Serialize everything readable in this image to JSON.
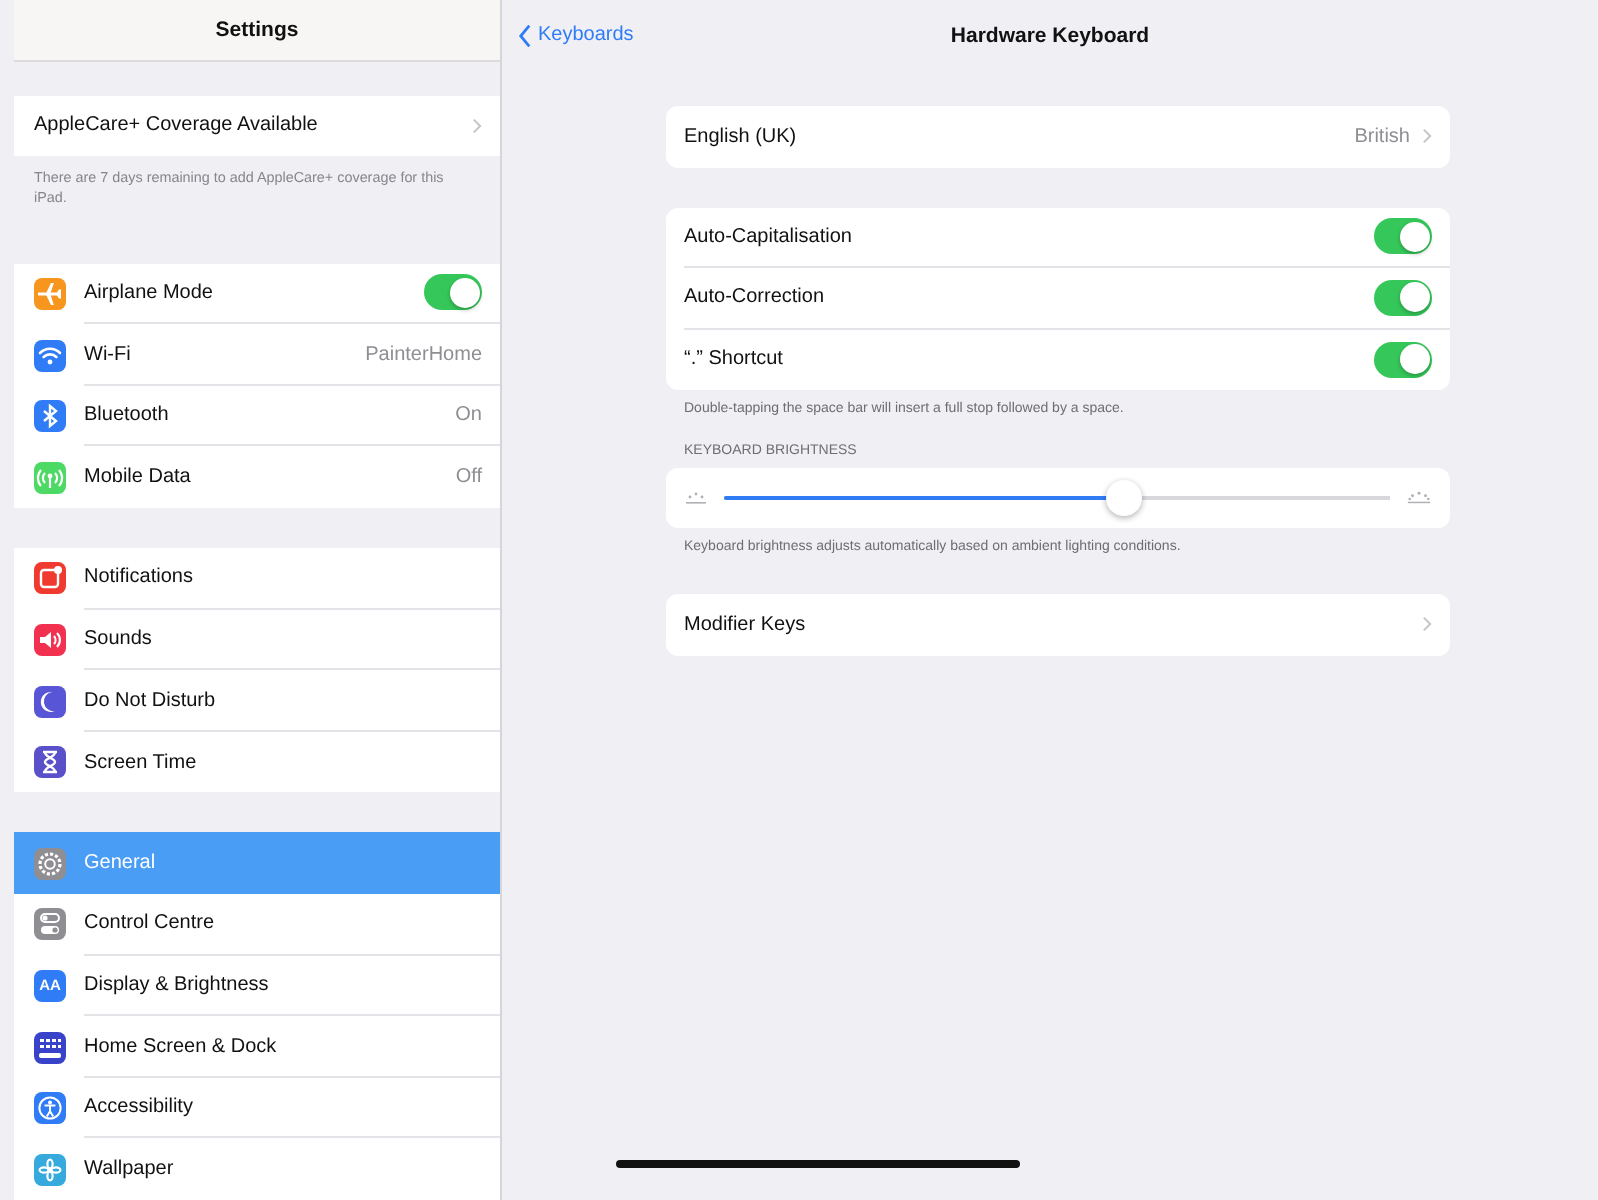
{
  "sidebar": {
    "title": "Settings",
    "groups": [
      {
        "rows": [
          {
            "label": "AppleCare+ Coverage Available",
            "kind": "link",
            "selected": false
          }
        ],
        "footer": "There are 7 days remaining to add AppleCare+ coverage for this iPad."
      },
      {
        "rows": [
          {
            "label": "Airplane Mode",
            "kind": "toggle",
            "on": true,
            "selected": false,
            "color": "#f7961e"
          },
          {
            "label": "Wi-Fi",
            "kind": "value",
            "value": "PainterHome",
            "selected": false,
            "color": "#2f7cf6"
          },
          {
            "label": "Bluetooth",
            "kind": "value",
            "value": "On",
            "selected": false,
            "color": "#2f7cf6"
          },
          {
            "label": "Mobile Data",
            "kind": "value",
            "value": "Off",
            "selected": false,
            "color": "#4cd964"
          }
        ]
      },
      {
        "rows": [
          {
            "label": "Notifications",
            "kind": "plain",
            "selected": false,
            "color": "#f03a2f"
          },
          {
            "label": "Sounds",
            "kind": "plain",
            "selected": false,
            "color": "#f2304f"
          },
          {
            "label": "Do Not Disturb",
            "kind": "plain",
            "selected": false,
            "color": "#5856d6"
          },
          {
            "label": "Screen Time",
            "kind": "plain",
            "selected": false,
            "color": "#5a50c9"
          }
        ]
      },
      {
        "rows": [
          {
            "label": "General",
            "kind": "plain",
            "selected": true,
            "color": "#8e8e93"
          },
          {
            "label": "Control Centre",
            "kind": "plain",
            "selected": false,
            "color": "#8e8e93"
          },
          {
            "label": "Display & Brightness",
            "kind": "plain",
            "selected": false,
            "color": "#2f7cf6",
            "icon_text": "AA"
          },
          {
            "label": "Home Screen & Dock",
            "kind": "plain",
            "selected": false,
            "color": "#3843c9"
          },
          {
            "label": "Accessibility",
            "kind": "plain",
            "selected": false,
            "color": "#2f7cf6"
          },
          {
            "label": "Wallpaper",
            "kind": "plain",
            "selected": false,
            "color": "#36aadc"
          }
        ]
      }
    ]
  },
  "nav": {
    "back": "Keyboards",
    "title": "Hardware Keyboard"
  },
  "sections": [
    {
      "kind": "list",
      "rows": [
        {
          "label": "English (UK)",
          "kind": "value",
          "value": "British"
        }
      ]
    },
    {
      "kind": "list",
      "rows": [
        {
          "label": "Auto-Capitalisation",
          "kind": "toggle",
          "on": true
        },
        {
          "label": "Auto-Correction",
          "kind": "toggle",
          "on": true
        },
        {
          "label": "“.” Shortcut",
          "kind": "toggle",
          "on": true
        }
      ],
      "footer": "Double-tapping the space bar will insert a full stop followed by a space."
    },
    {
      "kind": "slider",
      "header": "KEYBOARD BRIGHTNESS",
      "level": 0.6,
      "footer": "Keyboard brightness adjusts automatically based on ambient lighting conditions."
    },
    {
      "kind": "list",
      "rows": [
        {
          "label": "Modifier Keys",
          "kind": "link"
        }
      ]
    }
  ]
}
